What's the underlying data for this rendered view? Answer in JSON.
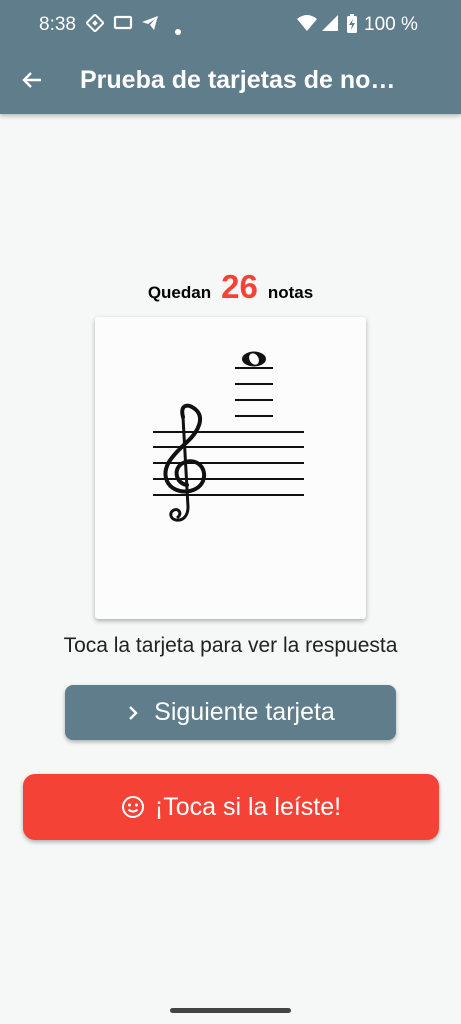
{
  "status_bar": {
    "time": "8:38",
    "battery": "100 %"
  },
  "toolbar": {
    "title": "Prueba de tarjetas de no…",
    "back_icon": "arrow-left-icon"
  },
  "counter": {
    "prefix": "Quedan",
    "count": "26",
    "suffix": "notas"
  },
  "card": {
    "clef": "treble-clef",
    "note": "whole-note-on-ledger-lines"
  },
  "hint": "Toca la tarjeta para ver la respuesta",
  "buttons": {
    "next_label": "Siguiente tarjeta",
    "read_label": "¡Toca si la leíste!"
  },
  "colors": {
    "primary": "#607d8b",
    "accent": "#f44336",
    "background": "#f6f7f7"
  }
}
